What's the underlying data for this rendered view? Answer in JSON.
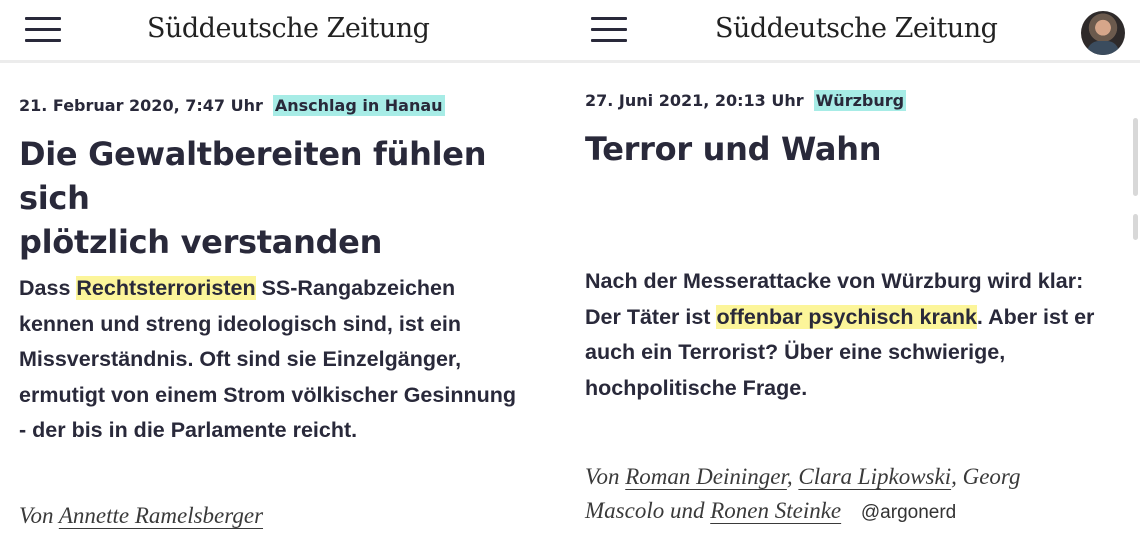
{
  "left": {
    "logo": "Süddeutsche Zeitung",
    "date": "21. Februar 2020, 7:47 Uhr",
    "tag": "Anschlag in Hanau",
    "headline_line1": "Die Gewaltbereiten fühlen sich",
    "headline_line2": "plötzlich verstanden",
    "teaser": {
      "l1_pre": "Dass ",
      "l1_highlight": "Rechtsterroristen",
      "l1_post": " SS-Rangabzeichen",
      "l2": "kennen und streng ideologisch sind, ist ein",
      "l3": "Missverständnis. Oft sind sie Einzelgänger,",
      "l4": "ermutigt von einem Strom völkischer Gesinnung",
      "l5": "- der bis in die Parlamente reicht."
    },
    "byline_prefix": "Von",
    "author": "Annette Ramelsberger"
  },
  "right": {
    "logo": "Süddeutsche Zeitung",
    "date": "27. Juni 2021, 20:13 Uhr",
    "tag": "Würzburg",
    "headline": "Terror und Wahn",
    "teaser": {
      "l1": "Nach der Messerattacke von Würzburg wird klar:",
      "l2_pre": "Der Täter ist ",
      "l2_highlight": "offenbar psychisch krank",
      "l2_post": ". Aber ist er",
      "l3": "auch ein Terrorist? Über eine schwierige,",
      "l4": "hochpolitische Frage."
    },
    "byline_prefix": "Von",
    "author1": "Roman Deininger",
    "comma1": ",",
    "author2": "Clara Lipkowski",
    "comma2": ",",
    "author3_line1": "Georg",
    "author3_line2": "Mascolo",
    "und": "und",
    "author4": "Ronen Steinke",
    "watermark": "@argonerd"
  },
  "colors": {
    "tag_bg": "#a7ece6",
    "highlight_bg": "#fcf59a",
    "text": "#29293a"
  },
  "icons": {
    "menu": "hamburger-menu-icon",
    "avatar": "user-avatar"
  }
}
